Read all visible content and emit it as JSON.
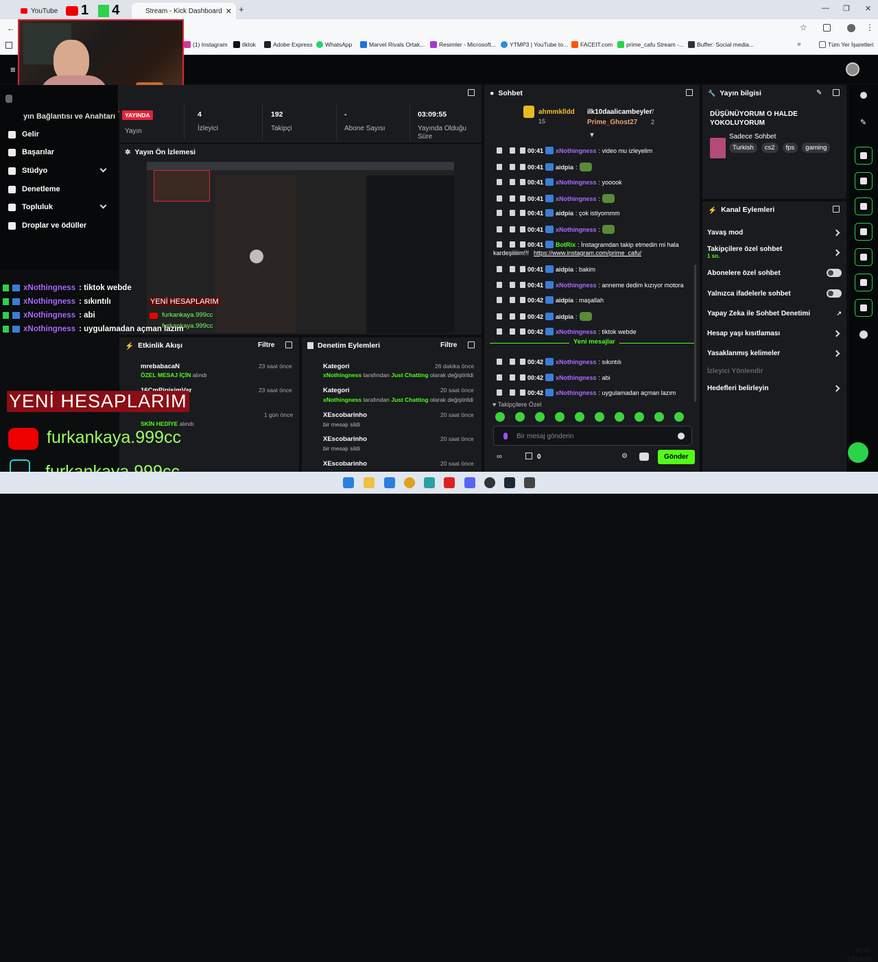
{
  "browser": {
    "tabs": [
      {
        "label": "YouTube"
      },
      {
        "label": "Stream - Kick Dashboard"
      }
    ],
    "overlay_counts": {
      "youtube_count": "1",
      "kick_count": "4"
    },
    "bookmarks": [
      "(1) Instagram",
      "tiktok",
      "Adobe Express",
      "WhatsApp",
      "Marvel Rivals Ortak...",
      "Resimler - Microsoft...",
      "YTMP3 | YouTube to...",
      "FACEIT.com",
      "prime_cafu Stream -...",
      "Buffer: Social media...",
      "Tüm Yer İşaretleri"
    ]
  },
  "sidebar": {
    "partial_title": "yın Bağlantısı ve Anahtarı",
    "items": [
      {
        "label": "Gelir"
      },
      {
        "label": "Başarılar"
      },
      {
        "label": "Stüdyo"
      },
      {
        "label": "Denetleme"
      },
      {
        "label": "Topluluk"
      },
      {
        "label": "Droplar ve ödüller"
      }
    ]
  },
  "stats": {
    "live_badge": "YAYINDA",
    "status_label": "Yayın",
    "viewers": {
      "value": "4",
      "label": "İzleyici"
    },
    "followers": {
      "value": "192",
      "label": "Takipçi"
    },
    "subscribers": {
      "value": "-",
      "label": "Abone Sayısı"
    },
    "uptime": {
      "value": "03:09:55",
      "label": "Yayında Olduğu Süre"
    }
  },
  "preview": {
    "title": "Yayın Ön İzlemesi",
    "overlay_new_accounts": "YENİ HESAPLARIM",
    "overlay_handle": "furkankaya.999cc"
  },
  "overlay_chat": [
    {
      "user": "xNothingness",
      "text": ": tiktok webde"
    },
    {
      "user": "xNothingness",
      "text": ": sıkıntılı"
    },
    {
      "user": "xNothingness",
      "text": ": abi"
    },
    {
      "user": "xNothingness",
      "text": ": uygulamadan açman lazım"
    }
  ],
  "overlay_socials": {
    "heading": "YENİ HESAPLARIM",
    "youtube": "furkankaya.999cc",
    "tiktok": "furkankaya.999cc"
  },
  "activity": {
    "title": "Etkinlik Akışı",
    "filter": "Filtre",
    "items": [
      {
        "user": "mrebabacaN",
        "time": "23 saat önce",
        "highlight": "ÖZEL MESAJ İÇİN",
        "rest": " alındı"
      },
      {
        "user": "16CmPipisimVar",
        "time": "23 saat önce",
        "highlight": "",
        "rest": ""
      },
      {
        "user": "",
        "time": "1 gün önce",
        "highlight": "SKİN HEDİYE",
        "rest": " alındı"
      }
    ]
  },
  "moderation": {
    "title": "Denetim Eylemleri",
    "filter": "Filtre",
    "items": [
      {
        "title": "Kategori",
        "time": "26 dakika önce",
        "user": "xNothingness",
        "mid": " tarafından ",
        "target": "Just Chatting",
        "end": " olarak değiştirildi"
      },
      {
        "title": "Kategori",
        "time": "20 saat önce",
        "user": "xNothingness",
        "mid": " tarafından ",
        "target": "Just Chatting",
        "end": " olarak değiştirildi"
      },
      {
        "title": "XEscobarinho",
        "time": "20 saat önce",
        "user": "",
        "mid": "bir mesajı sildi",
        "target": "",
        "end": ""
      },
      {
        "title": "XEscobarinho",
        "time": "20 saat önce",
        "user": "",
        "mid": "bir mesajı sildi",
        "target": "",
        "end": ""
      },
      {
        "title": "XEscobarinho",
        "time": "20 saat önce",
        "user": "",
        "mid": "",
        "target": "",
        "end": ""
      }
    ]
  },
  "chat": {
    "title": "Sohbet",
    "leaders": [
      {
        "name": "ahmmklldd",
        "count": "15"
      },
      {
        "name": "ilk10daalicambeyler",
        "count": "7"
      },
      {
        "name": "Prime_Ghost27",
        "count": "2"
      }
    ],
    "messages": [
      {
        "time": "00:41",
        "user": "xNothingness",
        "text": ": video mu izleyelim",
        "color": "#ac6bff"
      },
      {
        "time": "00:41",
        "user": "aidpia",
        "text": ":",
        "color": "#e8e8e8",
        "emote": true
      },
      {
        "time": "00:41",
        "user": "xNothingness",
        "text": ": yooook",
        "color": "#ac6bff"
      },
      {
        "time": "00:41",
        "user": "xNothingness",
        "text": ":",
        "color": "#ac6bff",
        "emote": true
      },
      {
        "time": "00:41",
        "user": "aidpia",
        "text": ": çok istiyommm",
        "color": "#e8e8e8"
      },
      {
        "time": "00:41",
        "user": "xNothingness",
        "text": ":",
        "color": "#ac6bff",
        "emote": true
      },
      {
        "time": "00:41",
        "user": "BotRix",
        "text": ": İnstagramdan takip etmedin mi hala",
        "color": "#53fc18"
      },
      {
        "time": "00:41",
        "user": "aidpia",
        "text": ": bakim",
        "color": "#e8e8e8"
      },
      {
        "time": "00:41",
        "user": "xNothingness",
        "text": ": anneme dedim kızıyor motora",
        "color": "#ac6bff"
      },
      {
        "time": "00:42",
        "user": "aidpia",
        "text": ": maşallah",
        "color": "#e8e8e8"
      },
      {
        "time": "00:42",
        "user": "aidpia",
        "text": ":",
        "color": "#e8e8e8",
        "emote": true
      },
      {
        "time": "00:42",
        "user": "xNothingness",
        "text": ": tiktok webde",
        "color": "#ac6bff"
      },
      {
        "time": "00:42",
        "user": "xNothingness",
        "text": ": sıkıntılı",
        "color": "#ac6bff"
      },
      {
        "time": "00:42",
        "user": "xNothingness",
        "text": ": abi",
        "color": "#ac6bff"
      },
      {
        "time": "00:42",
        "user": "xNothingness",
        "text": ": uygulamadan açman lazım",
        "color": "#ac6bff"
      }
    ],
    "botrix_cont": "kardeşiiiiim!!!",
    "botrix_link": "https://www.instagram.com/prime_cafu/",
    "new_messages": "Yeni mesajlar",
    "followers_only": "Takipçilere Özel",
    "input_placeholder": "Bir mesaj gönderin",
    "points": "0",
    "send": "Gönder"
  },
  "stream_info": {
    "title": "Yayın bilgisi",
    "stream_title": "DÜŞÜNÜYORUM O HALDE YOKOLUYORUM",
    "category": "Sadece Sohbet",
    "tags": [
      "Turkish",
      "cs2",
      "fps",
      "gaming"
    ]
  },
  "channel_actions": {
    "title": "Kanal Eylemleri",
    "items": [
      {
        "label": "Yavaş mod",
        "sub": "",
        "control": "chevron"
      },
      {
        "label": "Takipçilere özel sohbet",
        "sub": "1 sn.",
        "control": "chevron"
      },
      {
        "label": "Abonelere özel sohbet",
        "sub": "",
        "control": "toggle"
      },
      {
        "label": "Yalnızca ifadelerle sohbet",
        "sub": "",
        "control": "toggle"
      },
      {
        "label": "Yapay Zeka ile Sohbet Denetimi",
        "sub": "",
        "control": "external"
      },
      {
        "label": "Hesap yaşı kısıtlaması",
        "sub": "",
        "control": "chevron"
      },
      {
        "label": "Yasaklanmış kelimeler",
        "sub": "",
        "control": "chevron"
      },
      {
        "label": "İzleyici Yönlendir",
        "sub": "",
        "control": "disabled"
      },
      {
        "label": "Hedefleri belirleyin",
        "sub": "",
        "control": "chevron"
      }
    ]
  },
  "taskbar": {
    "time": "00:43",
    "date": "3.03.2026"
  },
  "colors": {
    "accent": "#53fc18",
    "panel": "#191b1f",
    "purple": "#ac6bff",
    "live": "#e0243a"
  }
}
